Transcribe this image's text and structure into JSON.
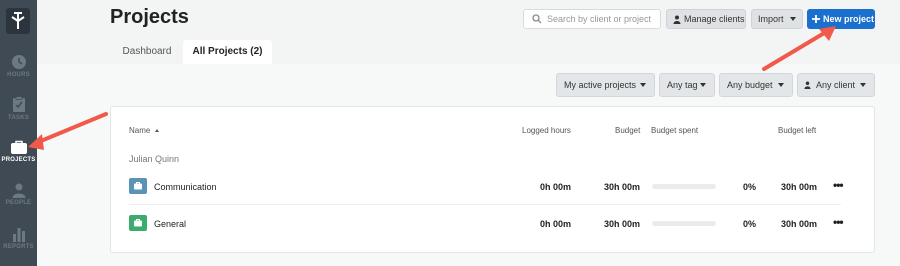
{
  "sidebar": {
    "items": [
      {
        "label": "HOURS",
        "icon": "clock-icon"
      },
      {
        "label": "TASKS",
        "icon": "clipboard-check-icon"
      },
      {
        "label": "PROJECTS",
        "icon": "briefcase-icon"
      },
      {
        "label": "PEOPLE",
        "icon": "person-icon"
      },
      {
        "label": "REPORTS",
        "icon": "bar-chart-icon"
      }
    ]
  },
  "header": {
    "title": "Projects",
    "search_placeholder": "Search by client or project",
    "manage_clients": "Manage clients",
    "import": "Import",
    "new_project": "New project"
  },
  "tabs": [
    {
      "label": "Dashboard"
    },
    {
      "label": "All Projects (2)"
    }
  ],
  "filters": {
    "active": "My active projects",
    "tag": "Any tag",
    "budget": "Any budget",
    "client": "Any client"
  },
  "table": {
    "columns": {
      "name": "Name",
      "logged": "Logged hours",
      "budget": "Budget",
      "spent": "Budget spent",
      "left": "Budget left"
    },
    "group": "Julian Quinn",
    "rows": [
      {
        "name": "Communication",
        "logged": "0h 00m",
        "budget": "30h 00m",
        "spent_pct": "0%",
        "spent_fraction": 0,
        "left": "30h 00m"
      },
      {
        "name": "General",
        "logged": "0h 00m",
        "budget": "30h 00m",
        "spent_pct": "0%",
        "spent_fraction": 0,
        "left": "30h 00m"
      }
    ]
  },
  "colors": {
    "sidebar_bg": "#3f4a54",
    "primary": "#1a6fcf",
    "annotation_arrow": "#f15a4a",
    "project_communication": "#5b93b7",
    "project_general": "#3dab6e"
  }
}
